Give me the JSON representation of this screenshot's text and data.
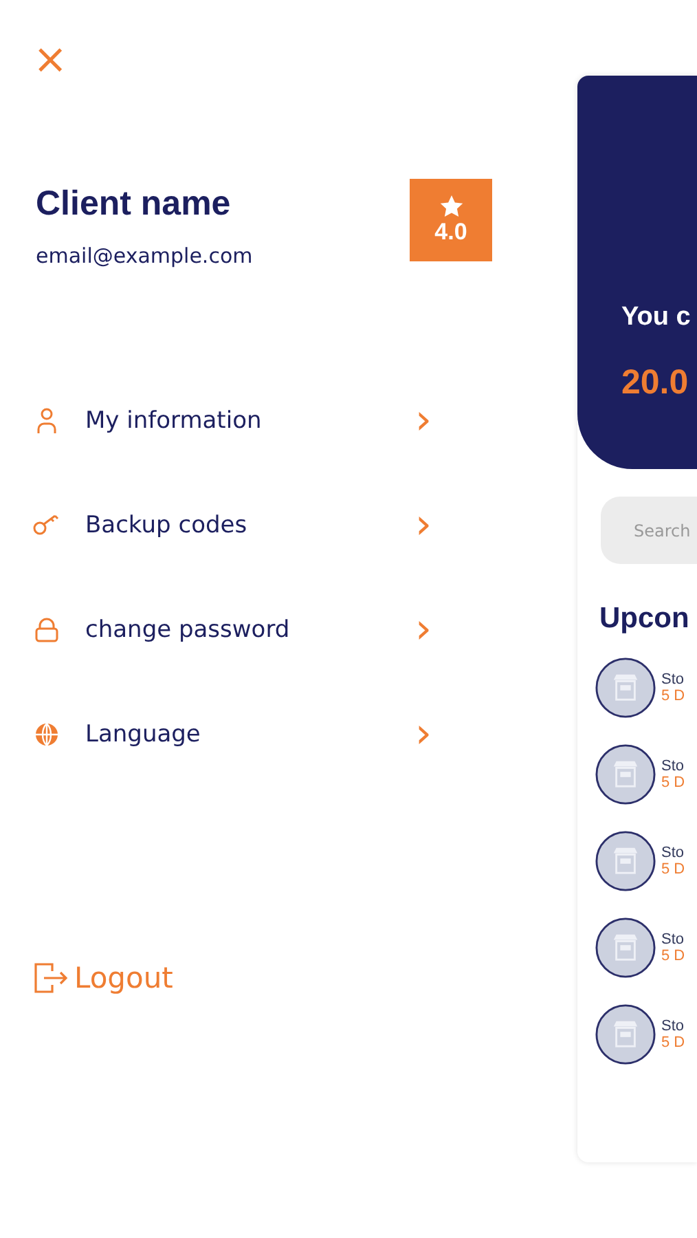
{
  "close_label": "×",
  "profile": {
    "name": "Client name",
    "email": "email@example.com",
    "rating": "4.0"
  },
  "menu": [
    {
      "label": "My information",
      "chevron": "›"
    },
    {
      "label": "Backup codes",
      "chevron": "›"
    },
    {
      "label": "change password",
      "chevron": "›"
    },
    {
      "label": "Language",
      "chevron": "›"
    }
  ],
  "logout": "Logout",
  "background_screen": {
    "header_text": "You c",
    "amount": "20.0",
    "search": {
      "placeholder": "Search"
    },
    "section_title": "Upcon",
    "items": [
      {
        "title": "Sto",
        "subtitle": "5 D"
      },
      {
        "title": "Sto",
        "subtitle": "5 D"
      },
      {
        "title": "Sto",
        "subtitle": "5 D"
      },
      {
        "title": "Sto",
        "subtitle": "5 D"
      },
      {
        "title": "Sto",
        "subtitle": "5 D"
      }
    ]
  }
}
